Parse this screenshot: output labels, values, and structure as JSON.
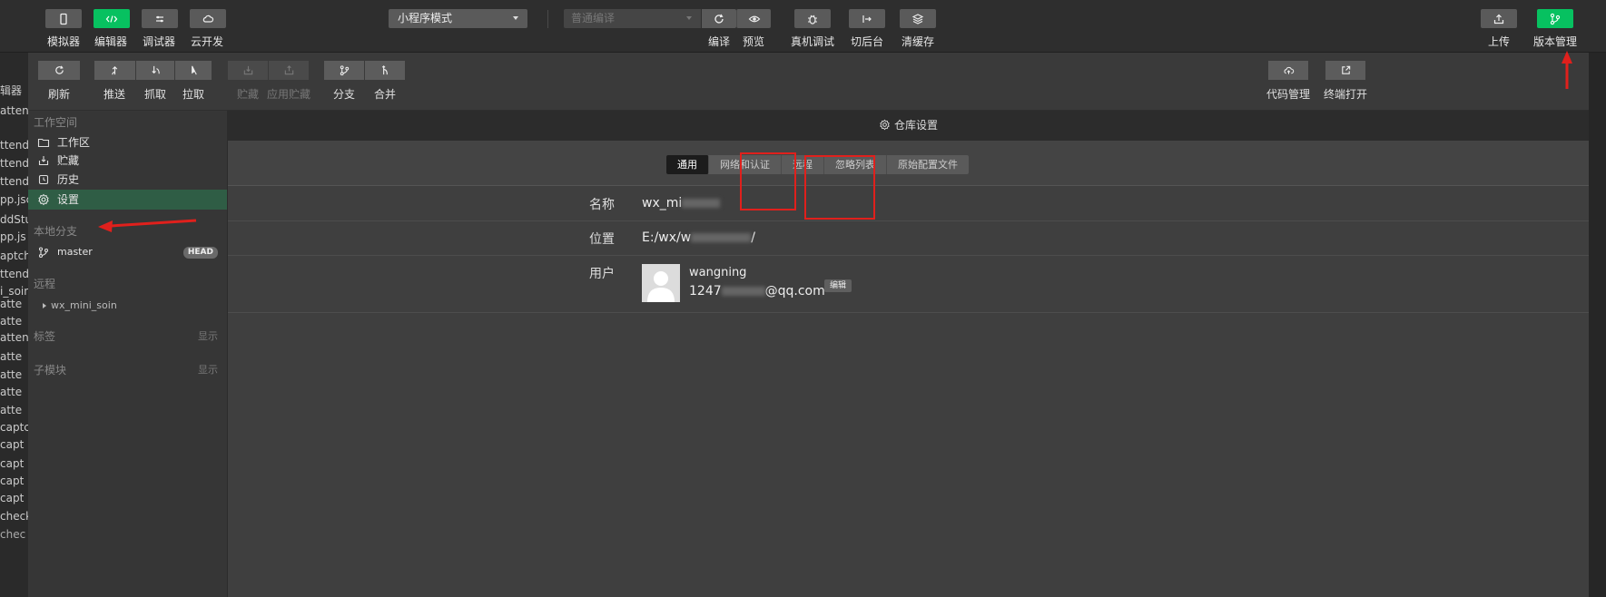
{
  "topbar": {
    "left_buttons": [
      {
        "label": "模拟器",
        "icon": "phone-icon",
        "active": false
      },
      {
        "label": "编辑器",
        "icon": "code-icon",
        "active": true
      },
      {
        "label": "调试器",
        "icon": "sliders-icon",
        "active": false
      },
      {
        "label": "云开发",
        "icon": "cloud-icon",
        "active": false
      }
    ],
    "mode_select": "小程序模式",
    "compile_select": "普通编译",
    "center_buttons": [
      {
        "label": "编译",
        "icon": "refresh-icon"
      },
      {
        "label": "预览",
        "icon": "eye-icon"
      },
      {
        "label": "真机调试",
        "icon": "bug-icon"
      },
      {
        "label": "切后台",
        "icon": "switch-icon"
      },
      {
        "label": "清缓存",
        "icon": "layers-icon"
      }
    ],
    "right_buttons": [
      {
        "label": "上传",
        "icon": "upload-icon",
        "active": false
      },
      {
        "label": "版本管理",
        "icon": "git-icon",
        "active": true
      }
    ]
  },
  "edge_files": [
    "辑器",
    "attend",
    "ttend(",
    "ttend(",
    "ttenda",
    "pp.jsc",
    "ddStu",
    "pp.js",
    "aptch",
    "ttend",
    "i_soin",
    "atte",
    "atte",
    "attenc",
    "atte",
    "atte",
    "atte",
    "atte",
    "captc",
    "capt",
    "capt",
    "capt",
    "capt",
    "check",
    "chec"
  ],
  "git_toolbar": {
    "buttons": [
      {
        "label": "刷新",
        "icon": "refresh-icon",
        "disabled": false
      },
      {
        "label": "推送",
        "icon": "push-icon",
        "disabled": false
      },
      {
        "label": "抓取",
        "icon": "fetch-icon",
        "disabled": false
      },
      {
        "label": "拉取",
        "icon": "pull-icon",
        "disabled": false
      },
      {
        "label": "贮藏",
        "icon": "stash-icon",
        "disabled": true
      },
      {
        "label": "应用贮藏",
        "icon": "apply-stash-icon",
        "disabled": true
      },
      {
        "label": "分支",
        "icon": "branch-icon",
        "disabled": false
      },
      {
        "label": "合并",
        "icon": "merge-icon",
        "disabled": false
      }
    ],
    "right_buttons": [
      {
        "label": "代码管理",
        "icon": "cloud-upload-icon"
      },
      {
        "label": "终端打开",
        "icon": "external-icon"
      }
    ]
  },
  "sidebar": {
    "workspace_header": "工作空间",
    "workspace_items": [
      {
        "label": "工作区",
        "icon": "folder-icon"
      },
      {
        "label": "贮藏",
        "icon": "stash-icon"
      },
      {
        "label": "历史",
        "icon": "history-icon"
      },
      {
        "label": "设置",
        "icon": "gear-icon",
        "active": true
      }
    ],
    "local_header": "本地分支",
    "branch": "master",
    "branch_badge": "HEAD",
    "remote_header": "远程",
    "remote_item": "wx_mini_soin",
    "tags_header": "标签",
    "tags_show": "显示",
    "submodule_header": "子模块",
    "submodule_show": "显示"
  },
  "content": {
    "title": "仓库设置",
    "tabs": [
      "通用",
      "网络和认证",
      "远程",
      "忽略列表",
      "原始配置文件"
    ],
    "active_tab": 0,
    "name_label": "名称",
    "name_value": "wx_mi",
    "location_label": "位置",
    "location_prefix": "E:/wx/w",
    "location_suffix": "/",
    "user_label": "用户",
    "user_name": "wangning",
    "user_email_prefix": "1247",
    "user_email_suffix": "@qq.com",
    "edit_label": "编辑"
  },
  "colors": {
    "accent_green": "#07c160",
    "annotation_red": "#e0201c",
    "active_sidebar": "#2f5d45"
  }
}
